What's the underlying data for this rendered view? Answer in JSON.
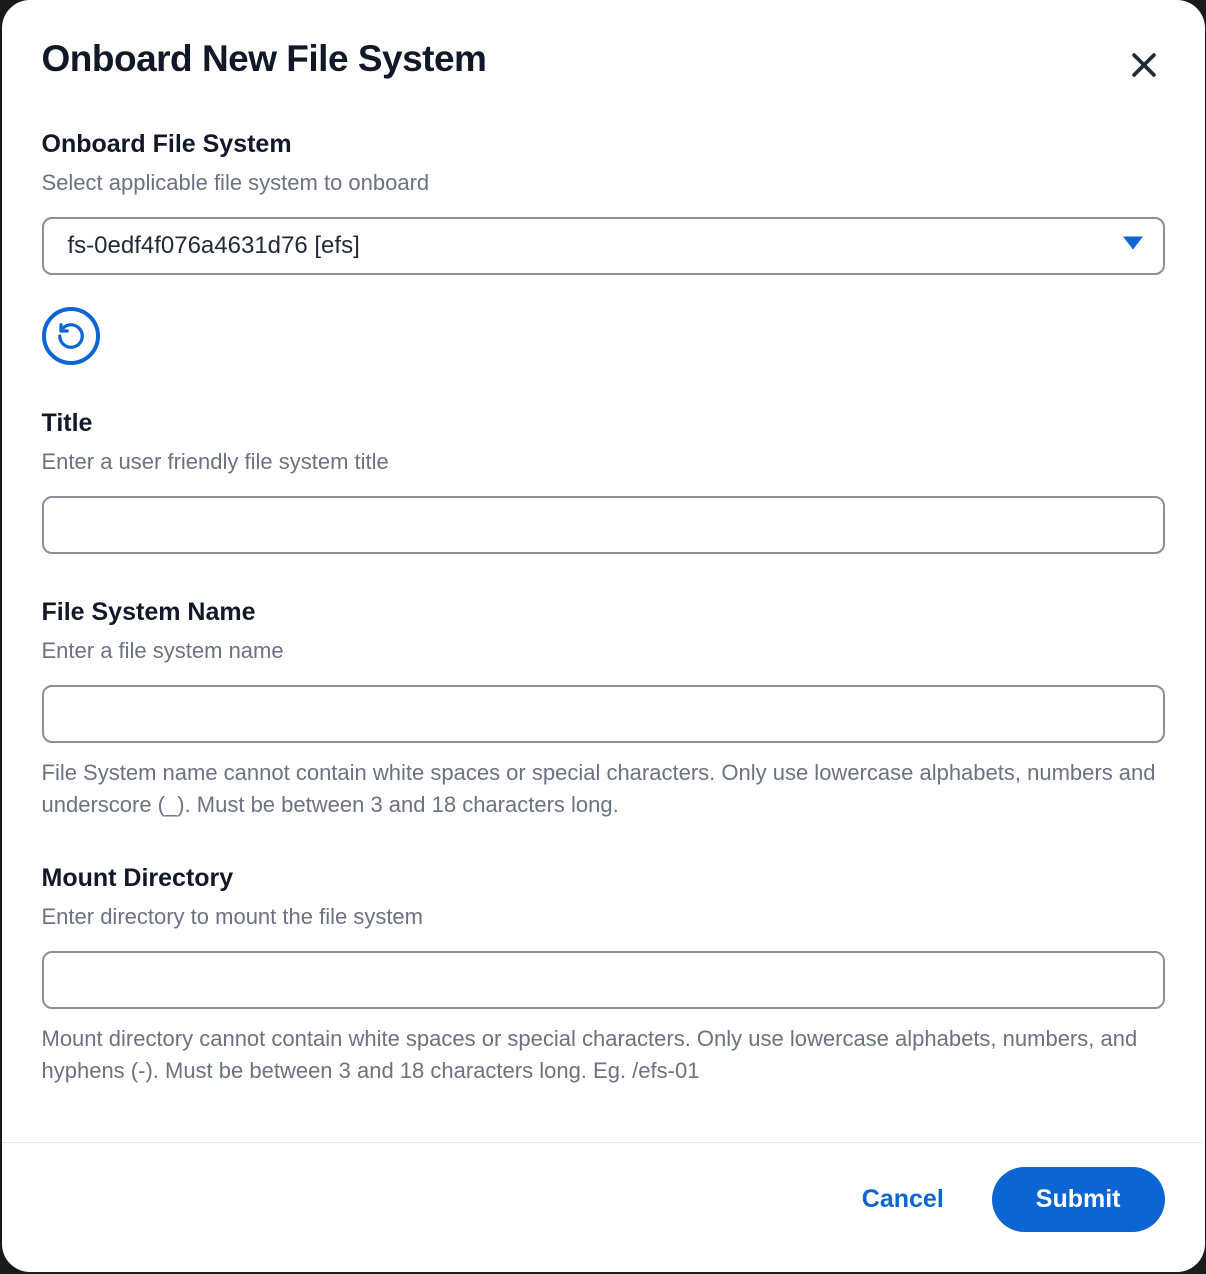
{
  "header": {
    "title": "Onboard New File System"
  },
  "onboard": {
    "label": "Onboard File System",
    "desc": "Select applicable file system to onboard",
    "selected": "fs-0edf4f076a4631d76 [efs]"
  },
  "title_field": {
    "label": "Title",
    "desc": "Enter a user friendly file system title",
    "value": ""
  },
  "fs_name": {
    "label": "File System Name",
    "desc": "Enter a file system name",
    "value": "",
    "help": "File System name cannot contain white spaces or special characters. Only use lowercase alphabets, numbers and underscore (_). Must be between 3 and 18 characters long."
  },
  "mount": {
    "label": "Mount Directory",
    "desc": "Enter directory to mount the file system",
    "value": "",
    "help": "Mount directory cannot contain white spaces or special characters. Only use lowercase alphabets, numbers, and hyphens (-). Must be between 3 and 18 characters long. Eg. /efs-01"
  },
  "footer": {
    "cancel": "Cancel",
    "submit": "Submit"
  },
  "icons": {
    "close": "close-icon",
    "caret": "caret-down-icon",
    "refresh": "refresh-icon"
  }
}
